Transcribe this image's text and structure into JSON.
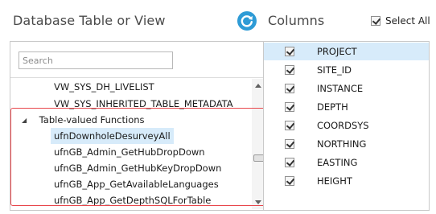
{
  "left_heading": "Database Table or View",
  "right_heading": "Columns",
  "refresh_icon": "refresh-icon",
  "accent_color": "#2e9bd6",
  "highlight_color": "#e8464b",
  "search": {
    "placeholder": "Search",
    "value": ""
  },
  "tree": {
    "rows": [
      {
        "kind": "leaf",
        "label": "VW_SYS_DH_LIVELIST",
        "selected": false
      },
      {
        "kind": "leaf",
        "label": "VW_SYS_INHERITED_TABLE_METADATA",
        "selected": false
      },
      {
        "kind": "group",
        "label": "Table-valued Functions",
        "expanded": true
      },
      {
        "kind": "leaf",
        "label": "ufnDownholeDesurveyAll",
        "selected": true
      },
      {
        "kind": "leaf",
        "label": "ufnGB_Admin_GetHubDropDown",
        "selected": false
      },
      {
        "kind": "leaf",
        "label": "ufnGB_Admin_GetHubKeyDropDown",
        "selected": false
      },
      {
        "kind": "leaf",
        "label": "ufnGB_App_GetAvailableLanguages",
        "selected": false
      },
      {
        "kind": "leaf",
        "label": "ufnGB_App_GetDepthSQLForTable",
        "selected": false
      }
    ]
  },
  "select_all": {
    "label": "Select All",
    "checked": true
  },
  "columns": [
    {
      "name": "PROJECT",
      "checked": true,
      "selected": true
    },
    {
      "name": "SITE_ID",
      "checked": true,
      "selected": false
    },
    {
      "name": "INSTANCE",
      "checked": true,
      "selected": false
    },
    {
      "name": "DEPTH",
      "checked": true,
      "selected": false
    },
    {
      "name": "COORDSYS",
      "checked": true,
      "selected": false
    },
    {
      "name": "NORTHING",
      "checked": true,
      "selected": false
    },
    {
      "name": "EASTING",
      "checked": true,
      "selected": false
    },
    {
      "name": "HEIGHT",
      "checked": true,
      "selected": false
    }
  ]
}
